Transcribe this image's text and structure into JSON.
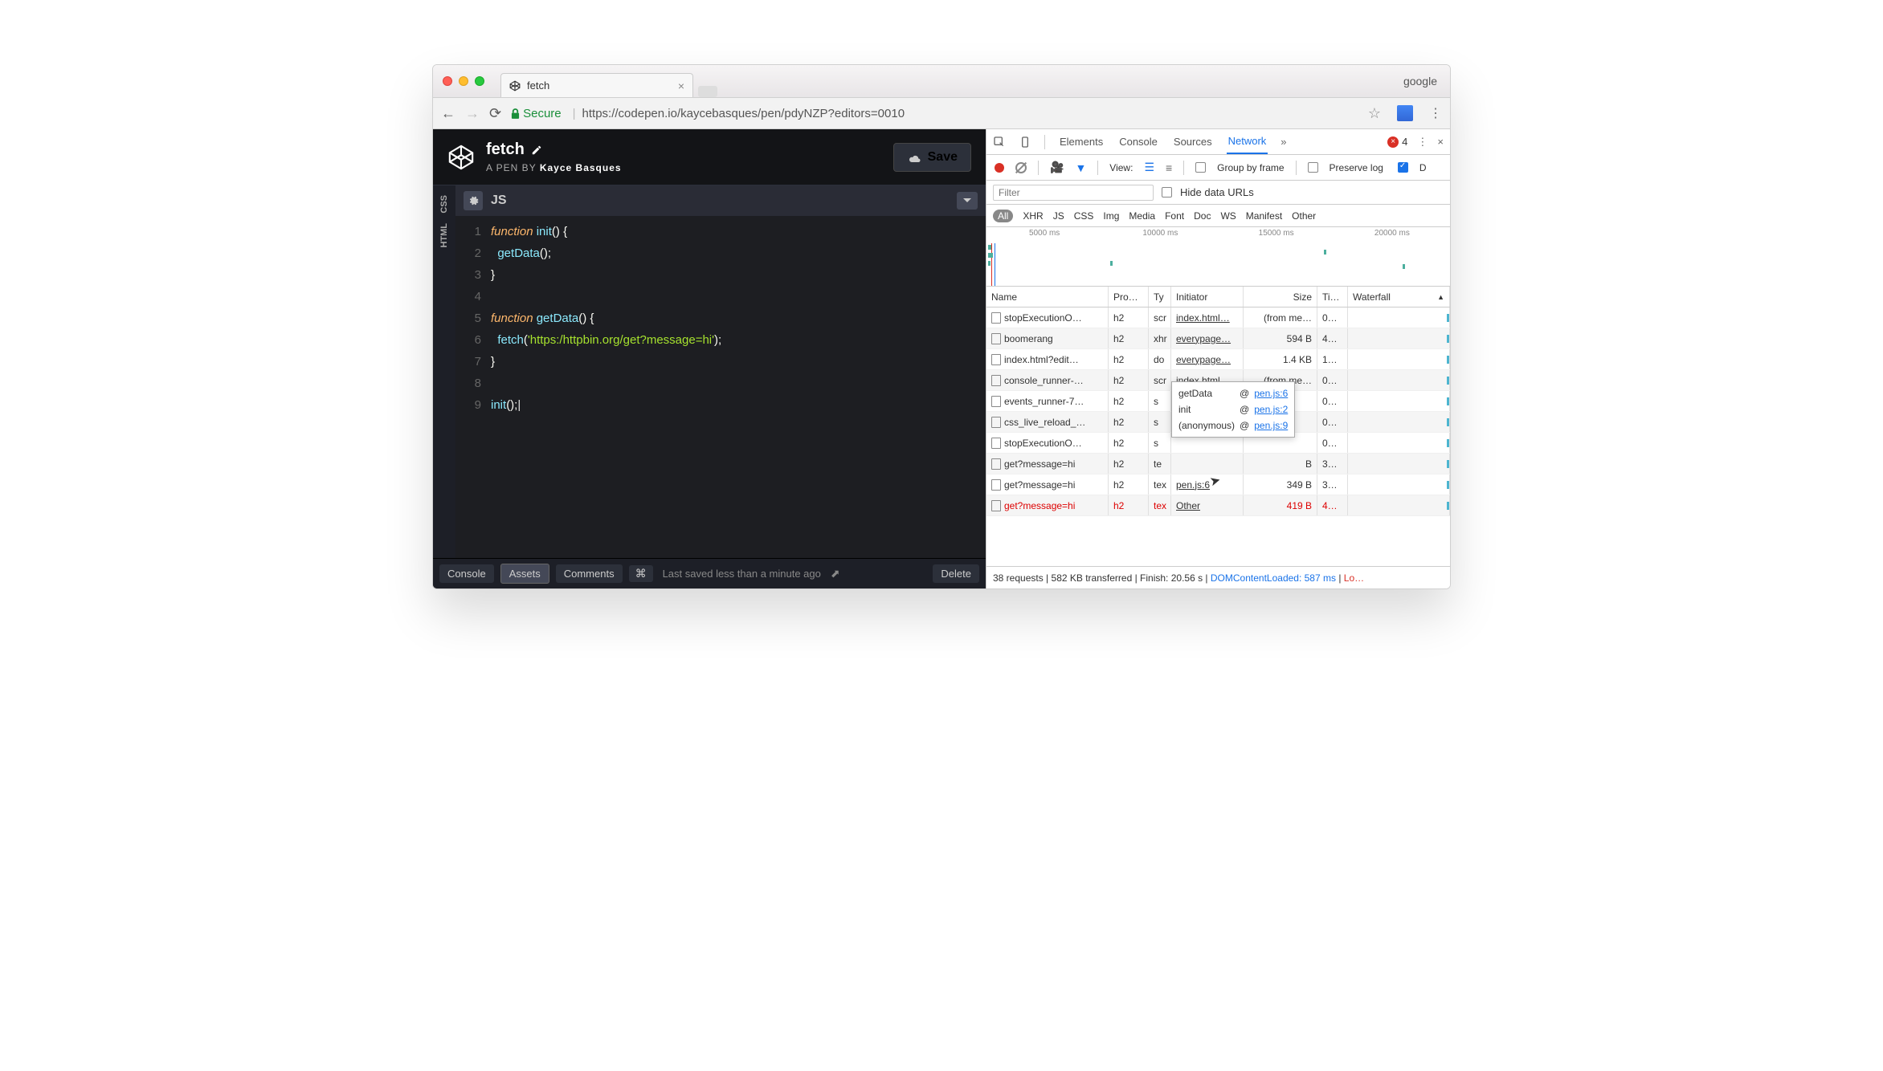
{
  "browser": {
    "tab_title": "fetch",
    "profile": "google",
    "secure_label": "Secure",
    "url_host_path": "https://codepen.io/kaycebasques/pen/pdyNZP?editors=0010"
  },
  "codepen": {
    "title": "fetch",
    "byline_prefix": "A PEN BY",
    "author": "Kayce Basques",
    "save_label": "Save",
    "sidebar": {
      "html": "HTML",
      "css": "CSS"
    },
    "editor_label": "JS",
    "code_lines": [
      {
        "n": "1",
        "html": "<span class='kw'>function</span> <span class='fn'>init</span><span class='pn'>() {</span>"
      },
      {
        "n": "2",
        "html": "  <span class='fn'>getData</span><span class='pn'>();</span>"
      },
      {
        "n": "3",
        "html": "<span class='pn'>}</span>"
      },
      {
        "n": "4",
        "html": ""
      },
      {
        "n": "5",
        "html": "<span class='kw'>function</span> <span class='fn'>getData</span><span class='pn'>() {</span>"
      },
      {
        "n": "6",
        "html": "  <span class='fn'>fetch</span><span class='pn'>(</span><span class='str'>'https:/httpbin.org/get?message=hi'</span><span class='pn'>);</span>"
      },
      {
        "n": "7",
        "html": "<span class='pn'>}</span>"
      },
      {
        "n": "8",
        "html": ""
      },
      {
        "n": "9",
        "html": "<span class='fn'>init</span><span class='pn'>();</span>|"
      }
    ],
    "footer": {
      "console": "Console",
      "assets": "Assets",
      "comments": "Comments",
      "shortcut": "⌘",
      "saved": "Last saved less than a minute ago",
      "delete": "Delete"
    }
  },
  "devtools": {
    "tabs": [
      "Elements",
      "Console",
      "Sources",
      "Network"
    ],
    "active_tab": "Network",
    "error_count": "4",
    "toolbar": {
      "view_label": "View:",
      "group_label": "Group by frame",
      "preserve_label": "Preserve log"
    },
    "filter_placeholder": "Filter",
    "hide_urls_label": "Hide data URLs",
    "types": [
      "All",
      "XHR",
      "JS",
      "CSS",
      "Img",
      "Media",
      "Font",
      "Doc",
      "WS",
      "Manifest",
      "Other"
    ],
    "active_type": "All",
    "timeline_labels": [
      "5000 ms",
      "10000 ms",
      "15000 ms",
      "20000 ms"
    ],
    "columns": {
      "name": "Name",
      "protocol": "Pro…",
      "type": "Ty",
      "initiator": "Initiator",
      "size": "Size",
      "time": "Ti…",
      "waterfall": "Waterfall"
    },
    "rows": [
      {
        "name": "stopExecutionO…",
        "pro": "h2",
        "ty": "scr",
        "init": "index.html…",
        "size": "(from me…",
        "ti": "0…",
        "wf": 98
      },
      {
        "name": "boomerang",
        "pro": "h2",
        "ty": "xhr",
        "init": "everypage…",
        "size": "594 B",
        "ti": "4…",
        "wf": 98
      },
      {
        "name": "index.html?edit…",
        "pro": "h2",
        "ty": "do",
        "init": "everypage…",
        "size": "1.4 KB",
        "ti": "1…",
        "wf": 98
      },
      {
        "name": "console_runner-…",
        "pro": "h2",
        "ty": "scr",
        "init": "index.html…",
        "size": "(from me…",
        "ti": "0…",
        "wf": 98
      },
      {
        "name": "events_runner-7…",
        "pro": "h2",
        "ty": "s",
        "init": "",
        "size": "",
        "ti": "0…",
        "wf": 98
      },
      {
        "name": "css_live_reload_…",
        "pro": "h2",
        "ty": "s",
        "init": "",
        "size": "",
        "ti": "0…",
        "wf": 98
      },
      {
        "name": "stopExecutionO…",
        "pro": "h2",
        "ty": "s",
        "init": "",
        "size": "",
        "ti": "0…",
        "wf": 98
      },
      {
        "name": "get?message=hi",
        "pro": "h2",
        "ty": "te",
        "init": "",
        "size": "B",
        "ti": "3…",
        "wf": 98
      },
      {
        "name": "get?message=hi",
        "pro": "h2",
        "ty": "tex",
        "init": "pen.js:6",
        "size": "349 B",
        "ti": "3…",
        "wf": 98
      },
      {
        "name": "get?message=hi",
        "pro": "h2",
        "ty": "tex",
        "init": "Other",
        "size": "419 B",
        "ti": "4…",
        "wf": 98,
        "error": true
      }
    ],
    "tooltip": [
      {
        "fn": "getData",
        "at": "@",
        "loc": "pen.js:6"
      },
      {
        "fn": "init",
        "at": "@",
        "loc": "pen.js:2"
      },
      {
        "fn": "(anonymous)",
        "at": "@",
        "loc": "pen.js:9"
      }
    ],
    "statusbar": {
      "requests": "38 requests",
      "transferred": "582 KB transferred",
      "finish": "Finish: 20.56 s",
      "dom": "DOMContentLoaded: 587 ms",
      "load": "Lo…"
    }
  }
}
